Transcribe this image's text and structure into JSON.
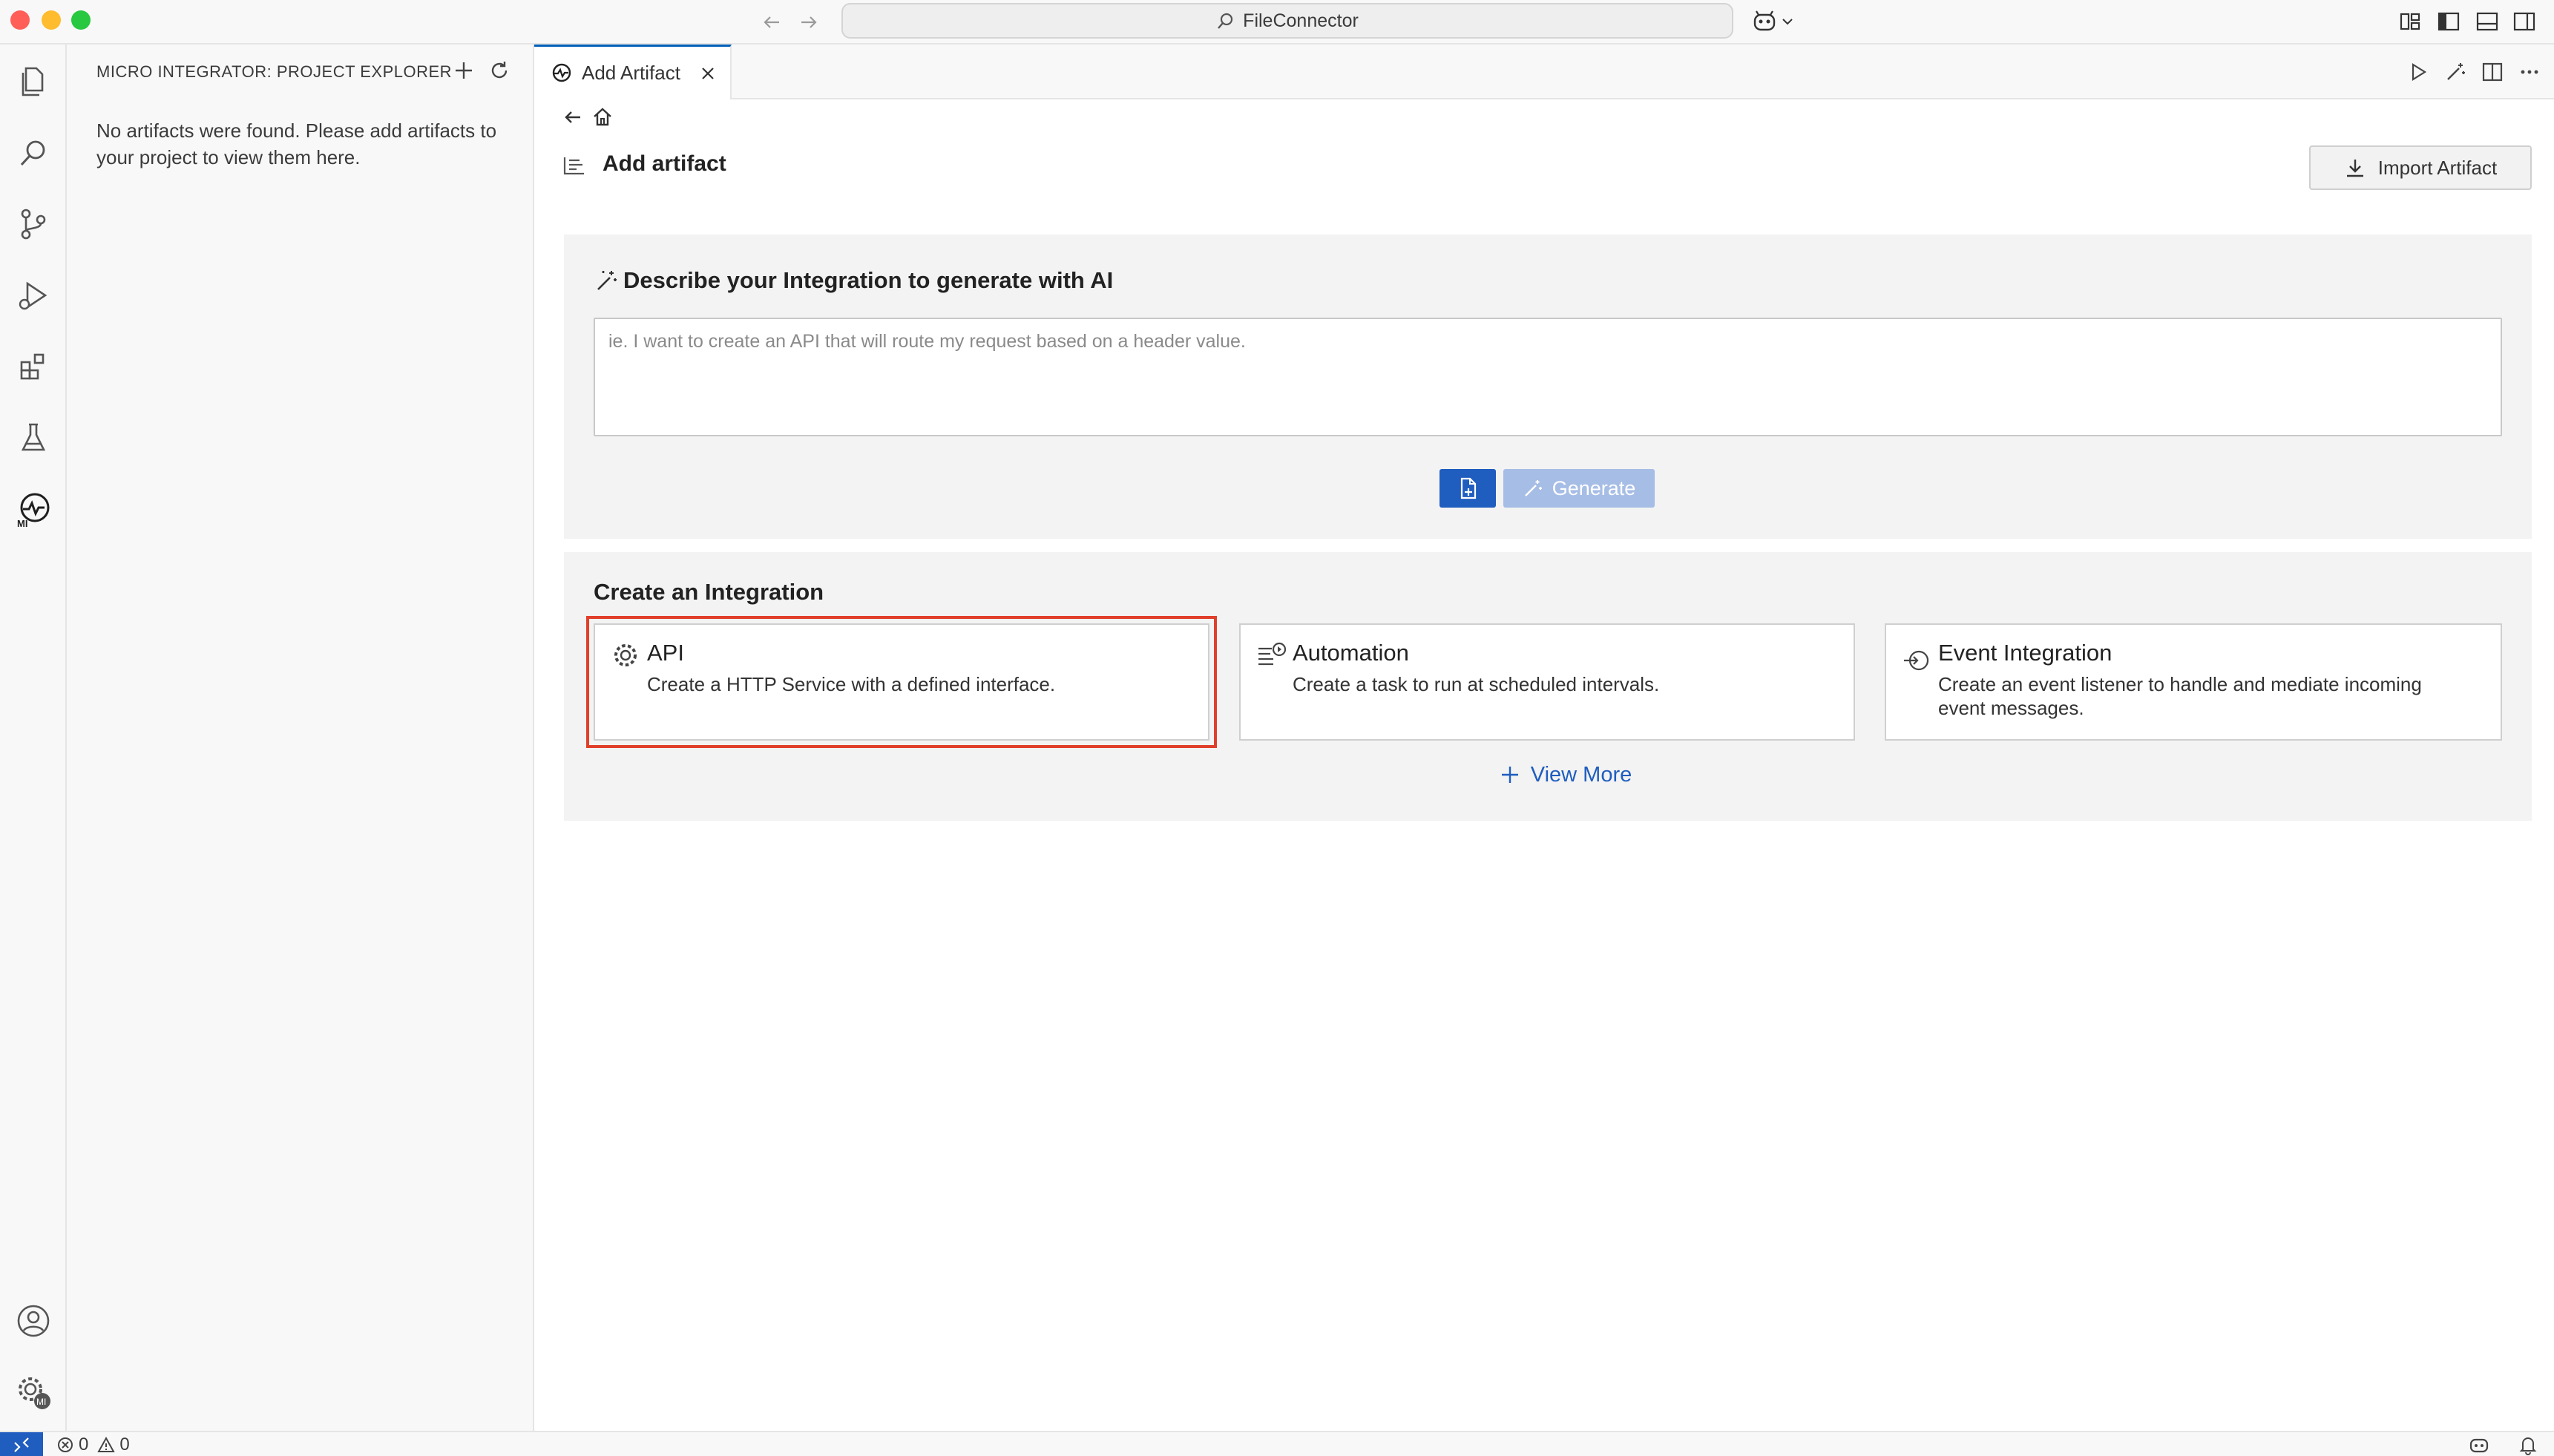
{
  "window": {
    "search_label": "FileConnector"
  },
  "sidebar": {
    "title": "MICRO INTEGRATOR: PROJECT EXPLORER",
    "empty_message": "No artifacts were found. Please add artifacts to your project to view them here."
  },
  "tabs": [
    {
      "label": "Add Artifact",
      "active": true
    }
  ],
  "page": {
    "heading": "Add artifact",
    "import_button": "Import Artifact"
  },
  "ai": {
    "title": "Describe your Integration to generate with AI",
    "placeholder": "ie. I want to create an API that will route my request based on a header value.",
    "generate_button": "Generate"
  },
  "create": {
    "title": "Create an Integration",
    "cards": [
      {
        "title": "API",
        "description": "Create a HTTP Service with a defined interface.",
        "icon": "gear-icon",
        "highlighted": true
      },
      {
        "title": "Automation",
        "description": "Create a task to run at scheduled intervals.",
        "icon": "task-schedule-icon"
      },
      {
        "title": "Event Integration",
        "description": "Create an event listener to handle and mediate incoming event messages.",
        "icon": "event-icon"
      }
    ],
    "view_more": "View More"
  },
  "statusbar": {
    "errors": "0",
    "warnings": "0"
  },
  "colors": {
    "accent": "#1f5dbf",
    "highlight": "#e0402b",
    "generate_disabled": "#a6bde6"
  }
}
